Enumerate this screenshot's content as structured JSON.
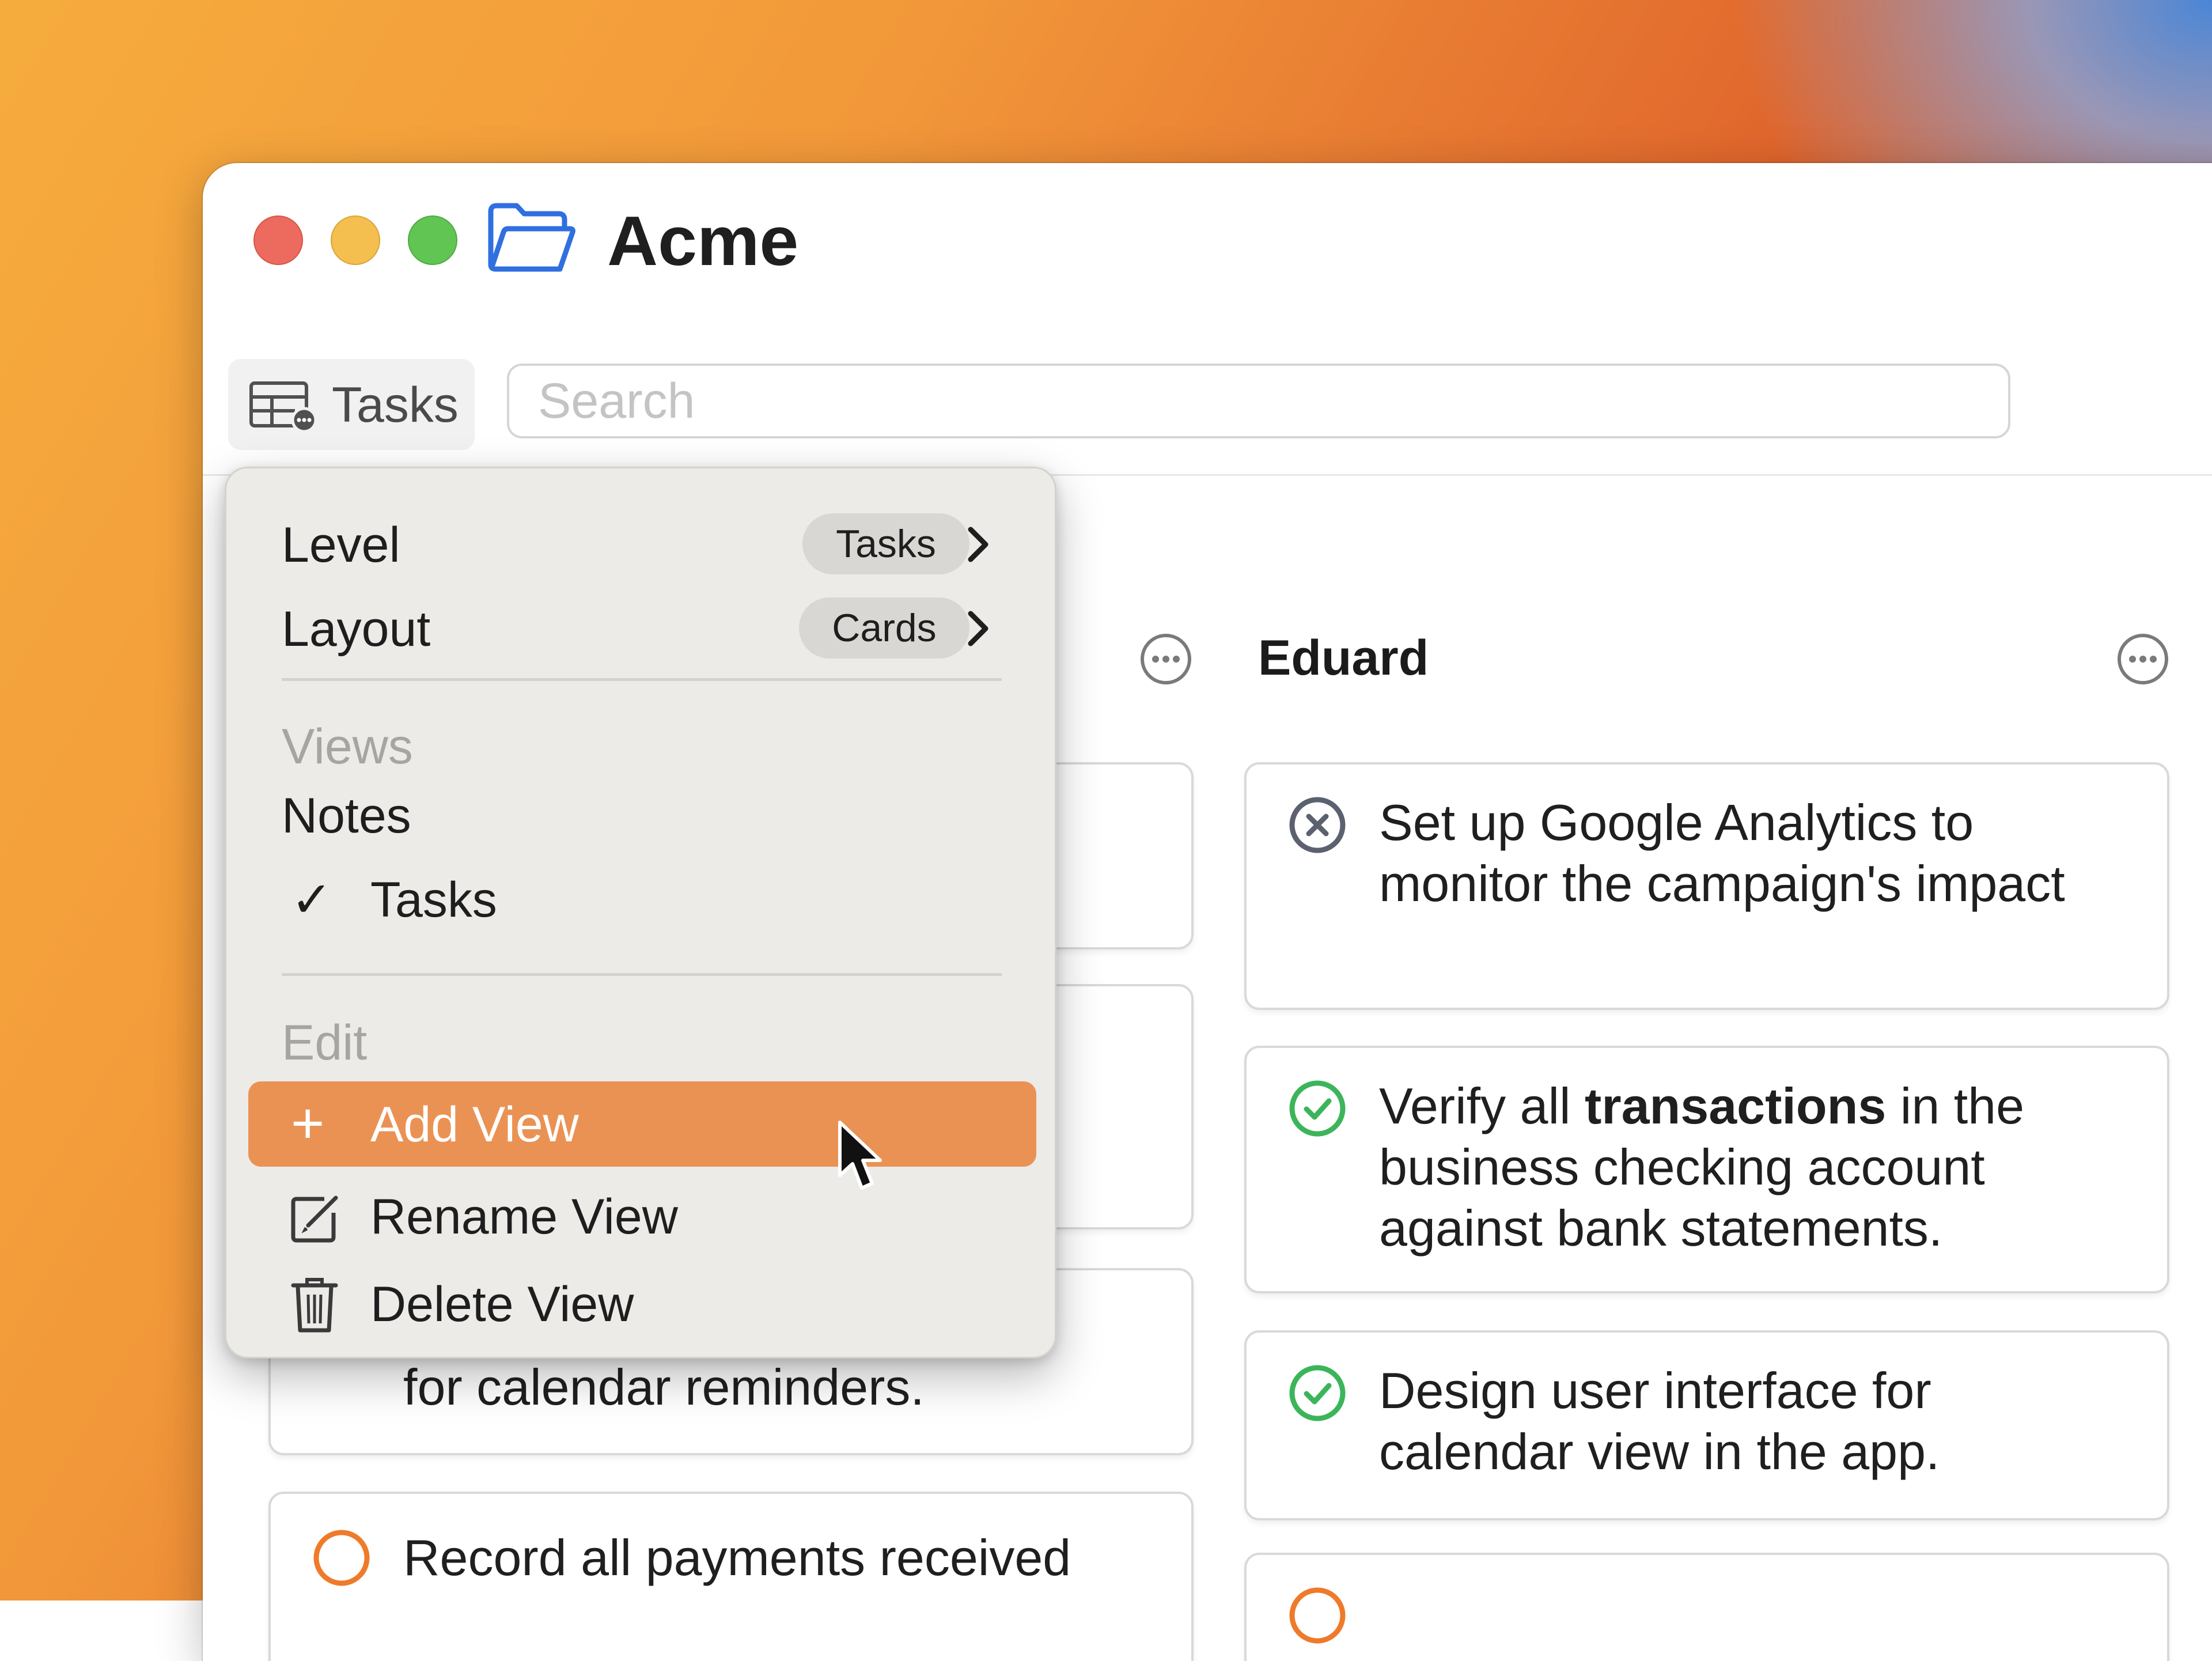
{
  "window": {
    "title": "Acme",
    "view_label": "Tasks",
    "search_placeholder": "Search"
  },
  "columns": {
    "left": {
      "cards": [
        {
          "text": "for calendar reminders.",
          "status": "partial"
        },
        {
          "text": "Record all payments received",
          "status": "open"
        }
      ]
    },
    "eduard": {
      "title": "Eduard",
      "cards": [
        {
          "text": "Set up Google Analytics to monitor the campaign's impact",
          "status": "cancelled"
        },
        {
          "text_before": "Verify all ",
          "text_bold": "transactions",
          "text_after": " in the business checking account against bank statements.",
          "status": "done"
        },
        {
          "text": "Design user interface for calendar view in the app.",
          "status": "done"
        },
        {
          "text": "",
          "status": "open"
        }
      ]
    }
  },
  "menu": {
    "level_label": "Level",
    "level_value": "Tasks",
    "layout_label": "Layout",
    "layout_value": "Cards",
    "views_header": "Views",
    "views": [
      {
        "label": "Notes",
        "checked": false
      },
      {
        "label": "Tasks",
        "checked": true
      }
    ],
    "check_glyph": "✓",
    "edit_header": "Edit",
    "add_view": "Add View",
    "add_glyph": "+",
    "rename_view": "Rename View",
    "delete_view": "Delete View"
  },
  "colors": {
    "accent_highlight": "#ea9254",
    "done_green": "#3cb55a",
    "open_orange": "#ef7a2a",
    "cancelled_gray": "#5c6170",
    "partial_blue": "#2f6fe0",
    "folder_blue": "#2f6fe0"
  },
  "icons": [
    "folder-open-icon",
    "table-view-icon",
    "more-icon",
    "cancel-circle-icon",
    "check-circle-icon",
    "empty-circle-icon",
    "chevron-right-icon",
    "checkmark-icon",
    "plus-icon",
    "rename-icon",
    "trash-icon",
    "pointer-cursor-icon"
  ]
}
